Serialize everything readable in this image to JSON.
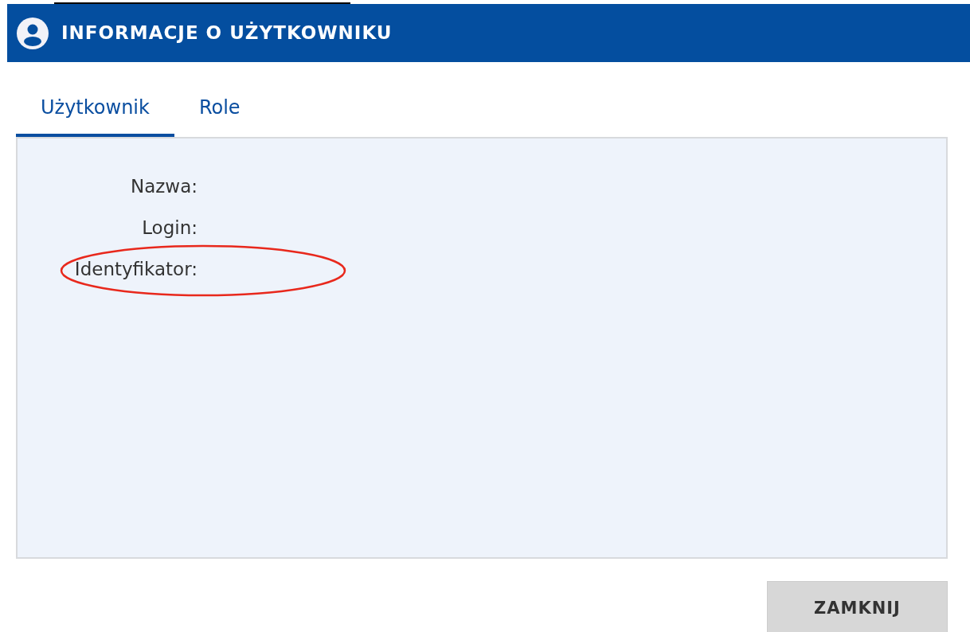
{
  "dialog": {
    "title": "INFORMACJE O UŻYTKOWNIKU"
  },
  "tabs": [
    {
      "label": "Użytkownik",
      "selected": true
    },
    {
      "label": "Role",
      "selected": false
    }
  ],
  "fields": [
    {
      "label": "Nazwa:",
      "highlighted": false
    },
    {
      "label": "Login:",
      "highlighted": false
    },
    {
      "label": "Identyfikator:",
      "highlighted": true
    }
  ],
  "buttons": [
    "ZAMKNIJ"
  ]
}
